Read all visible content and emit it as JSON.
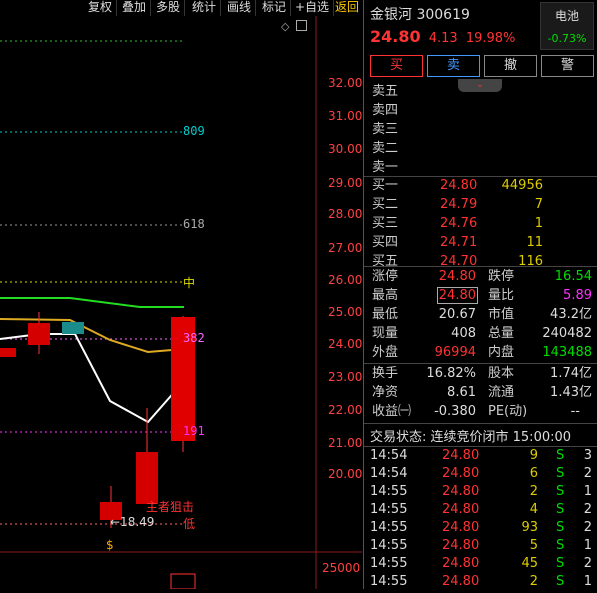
{
  "toolbar": [
    "复权",
    "叠加",
    "多股",
    "统计",
    "画线",
    "标记",
    "+自选",
    "返回"
  ],
  "chart": {
    "price_labels": [
      "32.00",
      "31.00",
      "30.00",
      "29.00",
      "28.00",
      "27.00",
      "26.00",
      "25.00",
      "24.00",
      "23.00",
      "22.00",
      "21.00",
      "20.00"
    ],
    "volume_label": "25000",
    "fib_labels": {
      "f809": "809",
      "f618": "618",
      "fmid": "中",
      "f382": "382",
      "f191": "191"
    },
    "low_marker": "←18.49",
    "annotation_1": "主者狙击",
    "annotation_2": "低",
    "s_marker": "$"
  },
  "stock": {
    "name": "金银河",
    "code": "300619",
    "price": "24.80",
    "change": "4.13",
    "pct": "19.98%",
    "sector": "电池",
    "sector_pct": "-0.73%"
  },
  "actions": [
    "买",
    "卖",
    "撤",
    "警"
  ],
  "asks": [
    {
      "label": "卖五",
      "price": "",
      "vol": ""
    },
    {
      "label": "卖四",
      "price": "",
      "vol": ""
    },
    {
      "label": "卖三",
      "price": "",
      "vol": ""
    },
    {
      "label": "卖二",
      "price": "",
      "vol": ""
    },
    {
      "label": "卖一",
      "price": "",
      "vol": ""
    }
  ],
  "bids": [
    {
      "label": "买一",
      "price": "24.80",
      "vol": "44956"
    },
    {
      "label": "买二",
      "price": "24.79",
      "vol": "7"
    },
    {
      "label": "买三",
      "price": "24.76",
      "vol": "1"
    },
    {
      "label": "买四",
      "price": "24.71",
      "vol": "11"
    },
    {
      "label": "买五",
      "price": "24.70",
      "vol": "116"
    }
  ],
  "stats": {
    "limit_up_l": "涨停",
    "limit_up": "24.80",
    "limit_down_l": "跌停",
    "limit_down": "16.54",
    "high_l": "最高",
    "high": "24.80",
    "vol_ratio_l": "量比",
    "vol_ratio": "5.89",
    "low_l": "最低",
    "low": "20.67",
    "mcap_l": "市值",
    "mcap": "43.2亿",
    "cur_vol_l": "现量",
    "cur_vol": "408",
    "total_vol_l": "总量",
    "total_vol": "240482",
    "outer_l": "外盘",
    "outer": "96994",
    "inner_l": "内盘",
    "inner": "143488",
    "turnover_l": "换手",
    "turnover": "16.82%",
    "equity_l": "股本",
    "equity": "1.74亿",
    "nav_l": "净资",
    "nav": "8.61",
    "float_l": "流通",
    "float": "1.43亿",
    "eps_l": "收益㈠",
    "eps": "-0.380",
    "pe_l": "PE(动)",
    "pe": "--"
  },
  "trade_status": "交易状态: 连续竞价闭市 15:00:00",
  "ticks": [
    {
      "time": "14:54",
      "price": "24.80",
      "vol": "9",
      "side": "S",
      "n": "3"
    },
    {
      "time": "14:54",
      "price": "24.80",
      "vol": "6",
      "side": "S",
      "n": "2"
    },
    {
      "time": "14:55",
      "price": "24.80",
      "vol": "2",
      "side": "S",
      "n": "1"
    },
    {
      "time": "14:55",
      "price": "24.80",
      "vol": "4",
      "side": "S",
      "n": "2"
    },
    {
      "time": "14:55",
      "price": "24.80",
      "vol": "93",
      "side": "S",
      "n": "2"
    },
    {
      "time": "14:55",
      "price": "24.80",
      "vol": "5",
      "side": "S",
      "n": "1"
    },
    {
      "time": "14:55",
      "price": "24.80",
      "vol": "45",
      "side": "S",
      "n": "2"
    },
    {
      "time": "14:55",
      "price": "24.80",
      "vol": "2",
      "side": "S",
      "n": "1"
    }
  ]
}
